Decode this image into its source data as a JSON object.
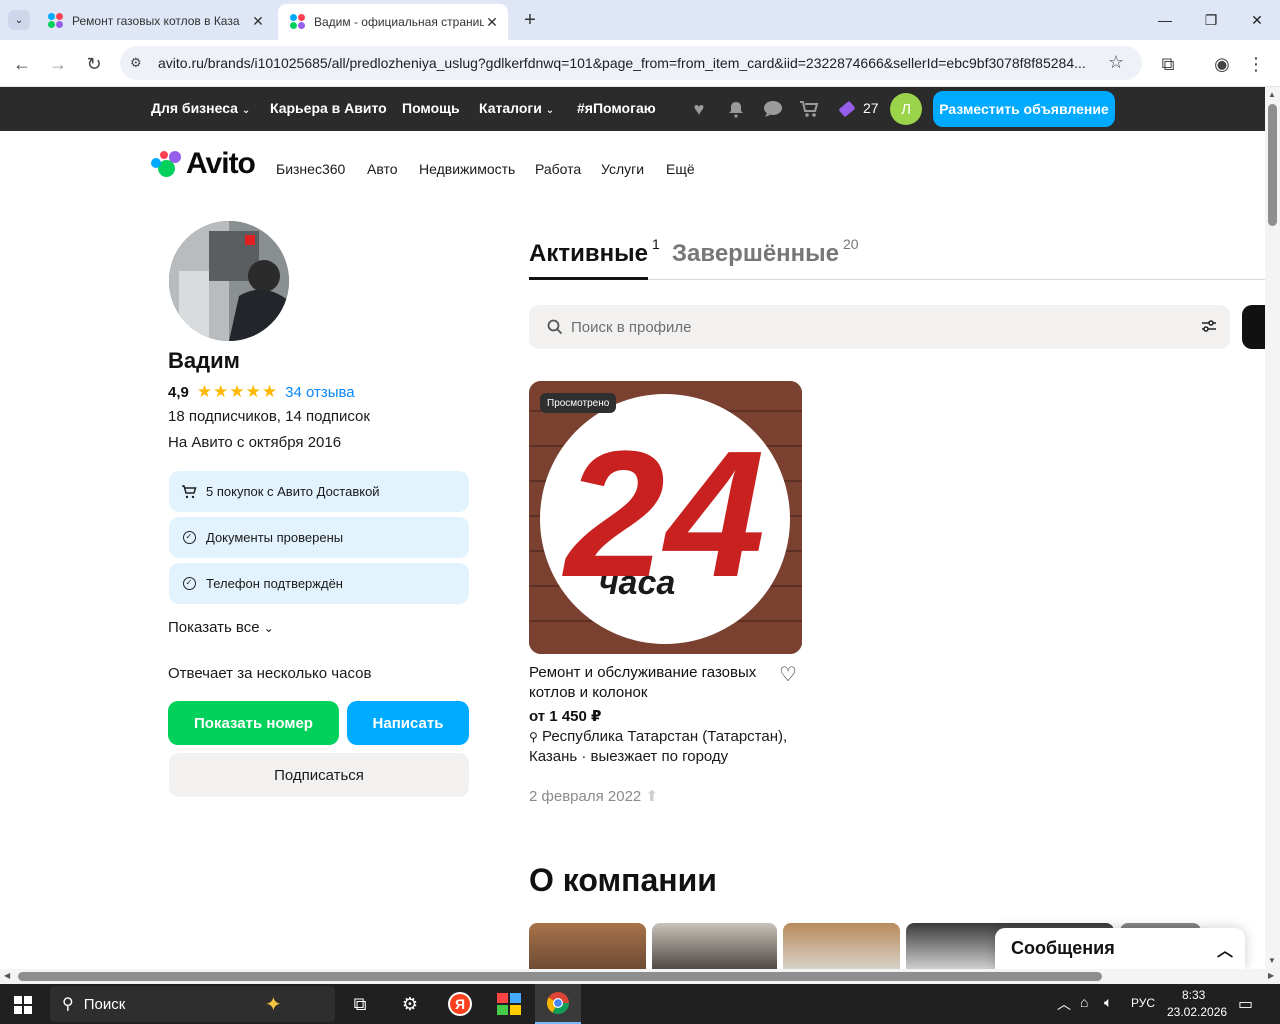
{
  "browser": {
    "tabs": [
      {
        "title": "Ремонт газовых котлов в Каза"
      },
      {
        "title": "Вадим - официальная страниц"
      }
    ],
    "url": "avito.ru/brands/i101025685/all/predlozheniya_uslug?gdlkerfdnwq=101&page_from=from_item_card&iid=2322874666&sellerId=ebc9bf3078f8f85284..."
  },
  "topbar": {
    "for_business": "Для бизнеса",
    "career": "Карьера в Авито",
    "help": "Помощь",
    "catalogs": "Каталоги",
    "hashtag": "#яПомогаю",
    "bonus_count": "27",
    "avatar_letter": "Л",
    "post_ad": "Разместить объявление"
  },
  "header": {
    "logo": "Avito",
    "nav": [
      "Бизнес360",
      "Авто",
      "Недвижимость",
      "Работа",
      "Услуги",
      "Ещё"
    ]
  },
  "profile": {
    "name": "Вадим",
    "rating": "4,9",
    "reviews": "34 отзыва",
    "followers": "18 подписчиков, 14 подписок",
    "since": "На Авито с октября 2016",
    "badges": [
      {
        "icon": "cart-icon",
        "label": "5 покупок с Авито Доставкой"
      },
      {
        "icon": "check-circle-icon",
        "label": "Документы проверены"
      },
      {
        "icon": "check-circle-icon",
        "label": "Телефон подтверждён"
      }
    ],
    "show_all": "Показать все",
    "response_time": "Отвечает за несколько часов",
    "show_phone": "Показать номер",
    "write": "Написать",
    "subscribe": "Подписаться"
  },
  "listings": {
    "tab_active": "Активные",
    "tab_active_count": "1",
    "tab_done": "Завершённые",
    "tab_done_count": "20",
    "search_placeholder": "Поиск в профиле",
    "items": [
      {
        "viewed": "Просмотрено",
        "image_text_big": "24",
        "image_text_small": "часа",
        "title": "Ремонт и обслуживание газовых котлов и колонок",
        "price": "от 1 450 ₽",
        "location": "Республика Татарстан (Татарстан), Казань · выезжает по городу",
        "date": "2 февраля 2022"
      }
    ]
  },
  "about": {
    "title": "О компании"
  },
  "messages": {
    "title": "Сообщения"
  },
  "taskbar": {
    "search": "Поиск",
    "lang": "РУС",
    "time": "8:33",
    "date": "23.02.2026"
  },
  "colors": {
    "accent_blue": "#00aaff",
    "green": "#02d15c",
    "badge_bg": "#e2f3fd",
    "star": "#ffb800"
  }
}
